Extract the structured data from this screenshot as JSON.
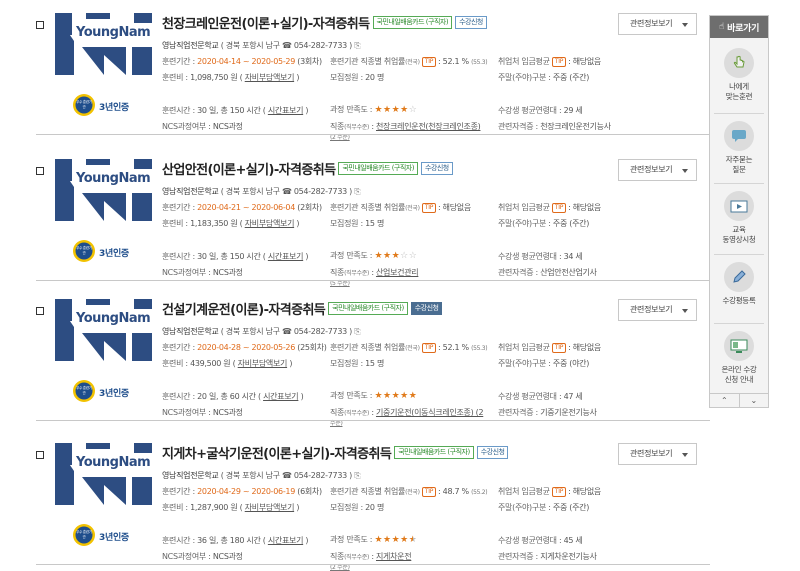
{
  "quick_menu": {
    "header": "바로가기",
    "items": [
      {
        "label": "나에게\n맞는훈련",
        "icon": "hand-pointer-icon"
      },
      {
        "label": "자주묻는\n질문",
        "icon": "chat-bubble-icon"
      },
      {
        "label": "교육\n동영상시청",
        "icon": "video-play-icon"
      },
      {
        "label": "수강평등록",
        "icon": "pencil-icon"
      },
      {
        "label": "온라인 수강\n신청 안내",
        "icon": "monitor-icon"
      }
    ],
    "up": "⌃",
    "down": "⌄"
  },
  "labels": {
    "period": "훈련기간 : ",
    "fee": "훈련비 : ",
    "hours": "훈련시간 : ",
    "ncs": "NCS과정여부 : ",
    "employment": "훈련기관 직종별 취업률",
    "employment_sub": "(전국)",
    "capacity": "모집정원 : ",
    "satisfaction": "과정 만족도 : ",
    "job_field": "직종",
    "job_field_sub": "(직무수준)",
    "wage": "취업처 임금평균",
    "shift": "주말(주야)구분 : ",
    "age": "수강생 평균연령대 : ",
    "qualification": "관련자격증 : ",
    "tip": "TIP",
    "subsidy_link": "자비부담액보기",
    "timetable_link": "시간표보기",
    "logo_text": "YoungNam",
    "cert_text": "3년인증",
    "cert_seal": "우수 훈련기관"
  },
  "courses": [
    {
      "title": "천장크레인운전(이론+실기)-자격증취득",
      "badge_card": "국민내일배움카드 (구직자)",
      "badge_apply": "수강신청",
      "apply_style": "outline",
      "institution": "영남직업전문학교",
      "address": "( 경북 포항시 남구 ☎ 054-282-7733 )",
      "period": "2020-04-14 ~ 2020-05-29",
      "rounds": "(3회차)",
      "employment": ": 52.1 %",
      "employment_sub": "(55.3)",
      "wage": ": 해당없음",
      "fee": "1,098,750 원",
      "capacity": "20 명",
      "shift": "주중 (주간)",
      "hours": "30 일, 총 150 시간",
      "stars": 4,
      "star_text": "★★★★",
      "star_off": "☆",
      "age": "29 세",
      "ncs": "NCS과정",
      "job": "천장크레인운전(천장크레인조종)",
      "job_level": "(2 수준)",
      "qualification": "천장크레인운전기능사",
      "dropdown": "관련정보보기"
    },
    {
      "title": "산업안전(이론+실기)-자격증취득",
      "badge_card": "국민내일배움카드 (구직자)",
      "badge_apply": "수강신청",
      "apply_style": "outline",
      "institution": "영남직업전문학교",
      "address": "( 경북 포항시 남구 ☎ 054-282-7733 )",
      "period": "2020-04-21 ~ 2020-06-04",
      "rounds": "(2회차)",
      "employment": ": 해당없음",
      "employment_sub": "",
      "wage": ": 해당없음",
      "fee": "1,183,350 원",
      "capacity": "15 명",
      "shift": "주중 (주간)",
      "hours": "30 일, 총 150 시간",
      "stars": 3,
      "star_text": "★★★",
      "star_off": "☆☆",
      "age": "34 세",
      "ncs": "NCS과정",
      "job": "산업보건관리",
      "job_level": "(5 수준)",
      "qualification": "산업안전산업기사",
      "dropdown": "관련정보보기"
    },
    {
      "title": "건설기계운전(이론)-자격증취득",
      "badge_card": "국민내일배움카드 (구직자)",
      "badge_apply": "수강신청",
      "apply_style": "solid",
      "institution": "영남직업전문학교",
      "address": "( 경북 포항시 남구 ☎ 054-282-7733 )",
      "period": "2020-04-28 ~ 2020-05-26",
      "rounds": "(25회차)",
      "employment": ": 52.1 %",
      "employment_sub": "(55.3)",
      "wage": ": 해당없음",
      "fee": "439,500 원",
      "capacity": "15 명",
      "shift": "주중 (야간)",
      "hours": "20 일, 총 60 시간",
      "stars": 5,
      "star_text": "★★★★★",
      "star_off": "",
      "age": "47 세",
      "ncs": "NCS과정",
      "job": "기중기운전(이동식크레인조종) (2",
      "job_level": "수준)",
      "qualification": "기중기운전기능사",
      "dropdown": "관련정보보기"
    },
    {
      "title": "지게차+굴삭기운전(이론+실기)-자격증취득",
      "badge_card": "국민내일배움카드 (구직자)",
      "badge_apply": "수강신청",
      "apply_style": "outline",
      "institution": "영남직업전문학교",
      "address": "( 경북 포항시 남구 ☎ 054-282-7733 )",
      "period": "2020-04-29 ~ 2020-06-19",
      "rounds": "(6회차)",
      "employment": ": 48.7 %",
      "employment_sub": "(55.2)",
      "wage": ": 해당없음",
      "fee": "1,287,900 원",
      "capacity": "20 명",
      "shift": "주중 (주간)",
      "hours": "36 일, 총 180 시간",
      "stars": 4.5,
      "star_text": "★★★★★",
      "star_off": "",
      "age": "45 세",
      "ncs": "NCS과정",
      "job": "지게차운전",
      "job_level": "(2 수준)",
      "qualification": "지게차운전기능사",
      "dropdown": "관련정보보기"
    }
  ]
}
